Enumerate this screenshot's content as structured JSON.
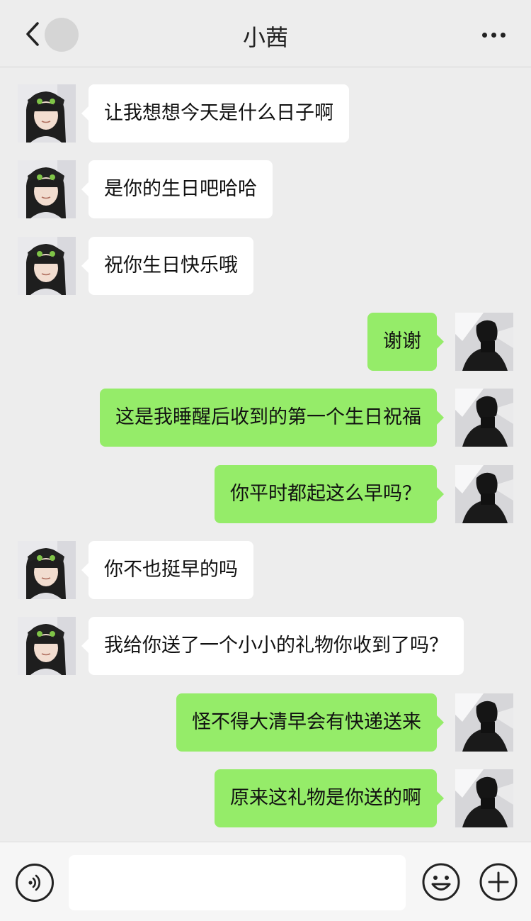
{
  "header": {
    "title": "小茜",
    "back_icon": "chevron-left-icon",
    "more_icon": "more-horizontal-icon"
  },
  "messages": [
    {
      "side": "left",
      "text": "让我想想今天是什么日子啊"
    },
    {
      "side": "left",
      "text": "是你的生日吧哈哈"
    },
    {
      "side": "left",
      "text": "祝你生日快乐哦"
    },
    {
      "side": "right",
      "text": "谢谢"
    },
    {
      "side": "right",
      "text": "这是我睡醒后收到的第一个生日祝福"
    },
    {
      "side": "right",
      "text": "你平时都起这么早吗？"
    },
    {
      "side": "left",
      "text": "你不也挺早的吗"
    },
    {
      "side": "left",
      "text": "我给你送了一个小小的礼物你收到了吗？"
    },
    {
      "side": "right",
      "text": "怪不得大清早会有快递送来"
    },
    {
      "side": "right",
      "text": "原来这礼物是你送的啊"
    }
  ],
  "footer": {
    "input_value": "",
    "voice_icon": "voice-icon",
    "emoji_icon": "emoji-icon",
    "plus_icon": "plus-icon"
  },
  "colors": {
    "background": "#ededed",
    "self_bubble": "#95ec69",
    "other_bubble": "#ffffff"
  }
}
